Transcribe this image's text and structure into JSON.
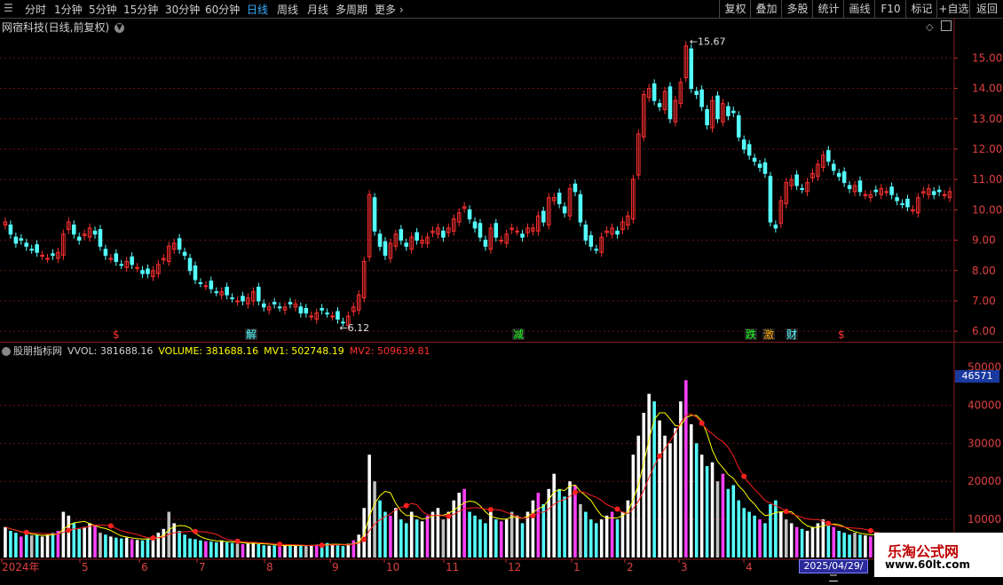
{
  "toolbar": {
    "periods": [
      "分时",
      "1分钟",
      "5分钟",
      "15分钟",
      "30分钟",
      "60分钟",
      "日线",
      "周线",
      "月线",
      "多周期",
      "更多"
    ],
    "active_period": "日线",
    "right_buttons": [
      "复权",
      "叠加",
      "多股",
      "统计",
      "画线",
      "F10",
      "标记",
      "+自选",
      "返回"
    ]
  },
  "stock": {
    "title": "网宿科技(日线,前复权)"
  },
  "indicator": {
    "name": "股朋指标网",
    "vvol": "VVOL: 381688.16",
    "volume": "VOLUME: 381688.16",
    "mv1": "MV1: 502748.19",
    "mv2": "MV2: 509639.81"
  },
  "price_axis": [
    "15.00",
    "14.00",
    "13.00",
    "12.00",
    "11.00",
    "10.00",
    "9.00",
    "8.00",
    "7.00",
    "6.00"
  ],
  "vol_axis": [
    "40000",
    "30000",
    "20000",
    "10000"
  ],
  "vol_axis_top": "50000",
  "vol_badge": "46571",
  "annotations": {
    "high": "15.67",
    "low": "6.12"
  },
  "events": [
    "$",
    "解",
    "减",
    "跌",
    "激",
    "财",
    "$"
  ],
  "x_axis": [
    "2024年",
    "5",
    "6",
    "7",
    "8",
    "9",
    "10",
    "11",
    "12",
    "1",
    "2",
    "3",
    "4"
  ],
  "date_badge": "2025/04/29/二",
  "watermark": {
    "line1": "乐淘公式网",
    "line2": "www.60lt.com"
  },
  "colors": {
    "up": "#ff3030",
    "down": "#54ffff",
    "mv1": "#ffff00",
    "mv2": "#ff2020",
    "grid": "#6a1010"
  },
  "chart_data": {
    "type": "candlestick",
    "price_range": [
      5.8,
      15.8
    ],
    "volume_range": [
      0,
      52000
    ],
    "close": [
      9.6,
      9.2,
      8.9,
      9.0,
      8.8,
      8.7,
      8.6,
      8.5,
      8.4,
      8.5,
      8.6,
      9.2,
      9.6,
      9.2,
      9.0,
      9.2,
      9.4,
      9.2,
      8.8,
      8.5,
      8.4,
      8.3,
      8.2,
      8.3,
      8.2,
      8.1,
      7.9,
      7.9,
      8.0,
      8.2,
      8.4,
      8.8,
      8.9,
      8.7,
      8.5,
      8.0,
      7.7,
      7.6,
      7.5,
      7.4,
      7.3,
      7.3,
      7.2,
      7.1,
      7.0,
      7.0,
      7.1,
      7.3,
      7.0,
      6.8,
      6.8,
      6.9,
      6.8,
      6.8,
      6.9,
      6.9,
      6.6,
      6.6,
      6.5,
      6.6,
      6.7,
      6.6,
      6.5,
      6.4,
      6.3,
      6.5,
      6.8,
      7.2,
      8.3,
      10.5,
      9.3,
      8.8,
      8.5,
      8.9,
      9.2,
      9.0,
      8.8,
      9.1,
      9.0,
      9.0,
      9.1,
      9.3,
      9.4,
      9.1,
      9.4,
      9.7,
      9.9,
      10.1,
      9.7,
      9.4,
      9.1,
      8.8,
      9.4,
      9.1,
      9.0,
      9.2,
      9.4,
      9.3,
      9.1,
      9.4,
      9.4,
      9.8,
      9.6,
      10.4,
      10.4,
      10.2,
      9.9,
      10.7,
      10.6,
      9.6,
      9.0,
      8.8,
      8.7,
      9.1,
      9.3,
      9.4,
      9.2,
      9.6,
      9.8,
      11.0,
      12.5,
      13.8,
      14.0,
      13.6,
      13.4,
      13.9,
      13.0,
      13.6,
      14.2,
      15.4,
      14.0,
      13.8,
      13.4,
      12.8,
      13.6,
      13.0,
      13.5,
      13.1,
      13.2,
      12.4,
      12.0,
      11.8,
      11.6,
      11.4,
      11.2,
      9.6,
      9.4,
      10.3,
      10.9,
      11.0,
      10.8,
      10.7,
      10.9,
      11.2,
      11.5,
      11.8,
      11.6,
      11.3,
      11.1,
      10.9,
      10.7,
      10.8,
      10.6,
      10.5,
      10.5,
      10.6,
      10.7,
      10.6,
      10.5,
      10.3,
      10.2,
      10.1,
      10.0,
      10.4,
      10.6,
      10.7,
      10.5,
      10.6,
      10.5,
      10.6
    ],
    "volume": [
      8000,
      7000,
      6500,
      5500,
      6000,
      5800,
      6000,
      5500,
      6000,
      6500,
      7000,
      12000,
      11000,
      9000,
      7500,
      8000,
      9000,
      8500,
      6500,
      6000,
      5500,
      5200,
      5000,
      5200,
      4800,
      4600,
      4500,
      5000,
      5500,
      6500,
      7500,
      12000,
      9000,
      7000,
      6000,
      5000,
      4800,
      4500,
      4300,
      4200,
      4000,
      4500,
      4000,
      3800,
      3600,
      3500,
      3800,
      4000,
      3500,
      3200,
      3100,
      3200,
      3000,
      3100,
      3200,
      3300,
      3100,
      3000,
      3200,
      3400,
      3600,
      3800,
      3400,
      3200,
      3000,
      3600,
      4500,
      6000,
      13000,
      27000,
      20000,
      15000,
      12000,
      11000,
      13000,
      10000,
      9000,
      12000,
      10000,
      9500,
      11000,
      12000,
      13000,
      10000,
      12000,
      15000,
      17000,
      18000,
      12000,
      11000,
      10000,
      9000,
      12000,
      10000,
      9500,
      10000,
      12000,
      11000,
      9000,
      12000,
      15000,
      17000,
      14000,
      18000,
      22000,
      18000,
      16000,
      20000,
      19000,
      14000,
      12000,
      10000,
      9000,
      10000,
      11000,
      12000,
      10000,
      12000,
      15000,
      27000,
      32000,
      38000,
      43000,
      41000,
      36000,
      32000,
      30000,
      34000,
      41000,
      46571,
      35000,
      30000,
      27000,
      24000,
      25000,
      20000,
      22000,
      18000,
      19000,
      15000,
      13000,
      12000,
      11000,
      10000,
      9000,
      14000,
      15000,
      12000,
      10000,
      9000,
      8000,
      7500,
      7000,
      8000,
      9000,
      10000,
      9000,
      8000,
      7000,
      6500,
      6000,
      6500,
      6000,
      5800,
      5500,
      6000,
      6500,
      6000,
      5800,
      5500,
      5200,
      5000,
      4800,
      5500,
      6000,
      5800,
      5200,
      5000,
      4800,
      5000
    ]
  }
}
